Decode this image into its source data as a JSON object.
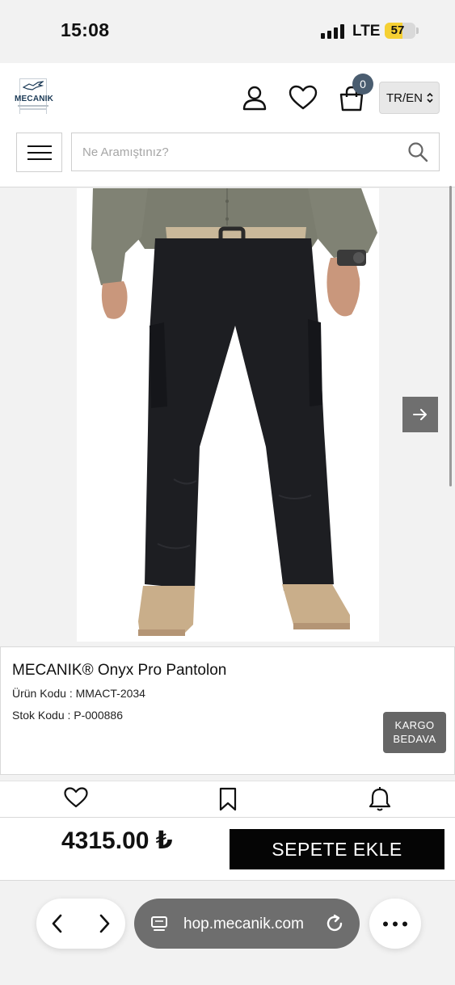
{
  "status_bar": {
    "time": "15:08",
    "network": "LTE",
    "battery": "57",
    "battery_level": 0.57,
    "battery_color": "#f5d033"
  },
  "header": {
    "logo_text": "MECANIK",
    "cart_count": "0",
    "language": "TR/EN",
    "icons": [
      "user-icon",
      "heart-icon",
      "shopping-bag-icon",
      "chevron-updown-icon",
      "hamburger-menu-icon",
      "search-icon"
    ],
    "search": {
      "placeholder": "Ne Aramıştınız?",
      "value": ""
    }
  },
  "product": {
    "title": "MECANIK® Onyx Pro Pantolon",
    "product_code": "Ürün Kodu : MMACT-2034",
    "stock_code": "Stok Kodu : P-000886",
    "badge_line1": "KARGO",
    "badge_line2": "BEDAVA",
    "badge_color": "#666666",
    "image_subject": "black cargo pants worn with olive shirt, tan belt and tan boots"
  },
  "actions": [
    "heart-icon",
    "bookmark-icon",
    "bell-icon"
  ],
  "purchase": {
    "price": "4315.00 ₺",
    "add_to_cart": "SEPETE EKLE"
  },
  "browser": {
    "url": "hop.mecanik.com",
    "icons": [
      "back-icon",
      "forward-icon",
      "tabs-icon",
      "reload-icon",
      "more-icon"
    ]
  }
}
